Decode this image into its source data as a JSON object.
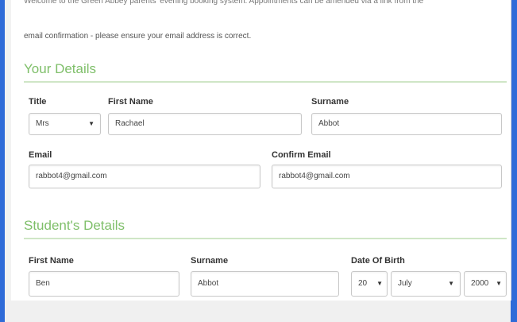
{
  "intro": {
    "line1": "Welcome to the Green Abbey parents' evening booking system. Appointments can be amended via a link from the",
    "line2": "email confirmation - please ensure your email address is correct."
  },
  "your_details": {
    "heading": "Your Details",
    "title_label": "Title",
    "title_value": "Mrs",
    "first_name_label": "First Name",
    "first_name_value": "Rachael",
    "surname_label": "Surname",
    "surname_value": "Abbot",
    "email_label": "Email",
    "email_value": "rabbot4@gmail.com",
    "confirm_email_label": "Confirm Email",
    "confirm_email_value": "rabbot4@gmail.com"
  },
  "student_details": {
    "heading": "Student's Details",
    "first_name_label": "First Name",
    "first_name_value": "Ben",
    "surname_label": "Surname",
    "surname_value": "Abbot",
    "dob_label": "Date Of Birth",
    "dob_day": "20",
    "dob_month": "July",
    "dob_year": "2000"
  },
  "colors": {
    "frame": "#2f6bd8",
    "heading": "#7fbf6a",
    "rule": "#cfe6c6"
  },
  "icons": {
    "select_caret": "caret-down-icon"
  }
}
